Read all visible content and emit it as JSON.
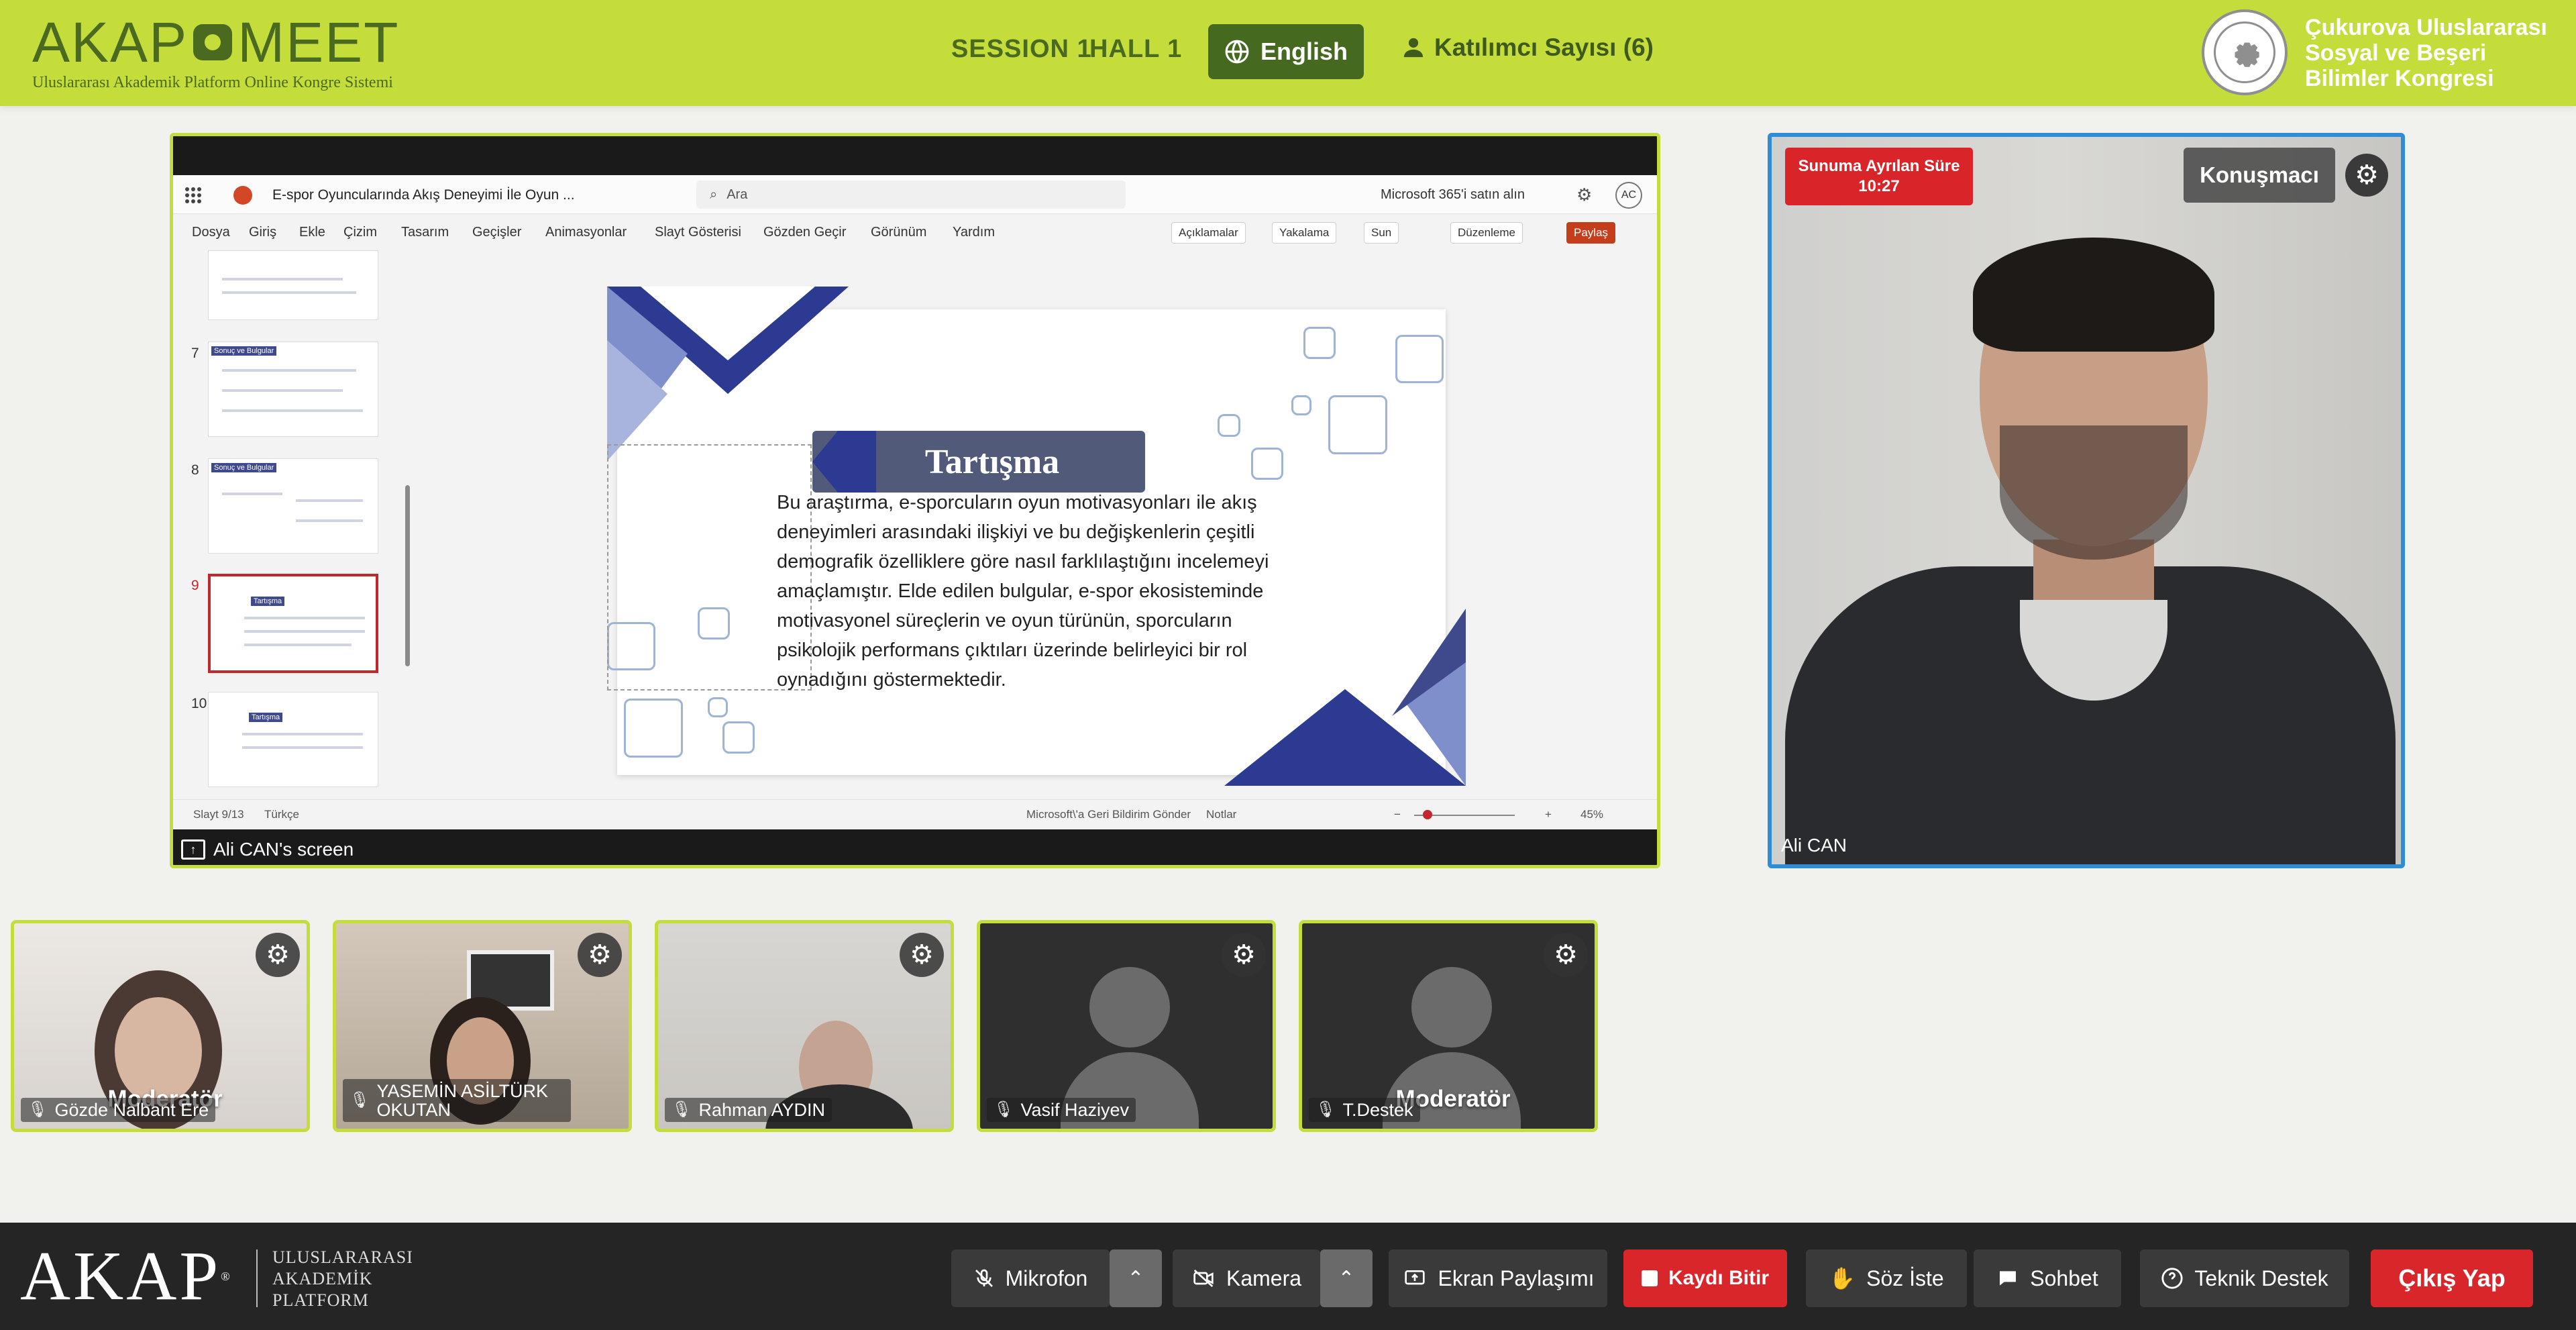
{
  "header": {
    "logo_text_left": "AKAP",
    "logo_text_right": "MEET",
    "logo_subtitle": "Uluslararası Akademik Platform Online Kongre Sistemi",
    "session": "SESSION 1",
    "hall": "HALL 1",
    "language_button": "English",
    "participants_label": "Katılımcı Sayısı (6)",
    "congress_name_line1": "Çukurova Uluslararası",
    "congress_name_line2": "Sosyal ve Beşeri",
    "congress_name_line3": "Bilimler Kongresi"
  },
  "presentation": {
    "share_label": "Ali CAN's screen",
    "ppt": {
      "doc_title": "E-spor Oyuncularında Akış Deneyimi İle Oyun ...",
      "search_placeholder": "Ara",
      "ms365": "Microsoft 365'i satın alın",
      "account_initials": "AC",
      "menu": [
        "Dosya",
        "Giriş",
        "Ekle",
        "Çizim",
        "Tasarım",
        "Geçişler",
        "Animasyonlar",
        "Slayt Gösterisi",
        "Gözden Geçir",
        "Görünüm",
        "Yardım"
      ],
      "ribbon": {
        "comments": "Açıklamalar",
        "catch": "Yakalama",
        "present": "Sun",
        "edit": "Düzenleme",
        "share": "Paylaş"
      },
      "thumbnails": [
        {
          "num": "7",
          "label": "Sonuç ve Bulgular"
        },
        {
          "num": "8",
          "label": "Sonuç ve Bulgular"
        },
        {
          "num": "9",
          "label": "Tartışma"
        },
        {
          "num": "10",
          "label": "Tartışma"
        }
      ],
      "slide": {
        "title": "Tartışma",
        "body": "Bu araştırma, e-sporcuların oyun motivasyonları ile akış deneyimleri arasındaki ilişkiyi ve bu değişkenlerin çeşitli demografik özelliklere göre nasıl farklılaştığını incelemeyi amaçlamıştır. Elde edilen bulgular, e-spor ekosisteminde motivasyonel süreçlerin ve oyun türünün, sporcuların psikolojik performans çıktıları üzerinde belirleyici bir rol oynadığını göstermektedir."
      },
      "status": {
        "slide_count": "Slayt 9/13",
        "language": "Türkçe",
        "feedback": "Microsoft\\'a Geri Bildirim Gönder",
        "notes": "Notlar",
        "zoom": "45%"
      }
    }
  },
  "speaker": {
    "timer_label": "Sunuma Ayrılan Süre",
    "timer_value": "10:27",
    "role": "Konuşmacı",
    "name": "Ali CAN"
  },
  "participants": [
    {
      "name": "Gözde Nalbant Ere",
      "role": "Moderatör"
    },
    {
      "name": "YASEMİN ASİLTÜRK OKUTAN",
      "role": ""
    },
    {
      "name": "Rahman AYDIN",
      "role": ""
    },
    {
      "name": "Vasif Haziyev",
      "role": ""
    },
    {
      "name": "T.Destek",
      "role": "Moderatör"
    }
  ],
  "footer": {
    "brand": "AKAP",
    "brand_line1": "ULUSLARARASI",
    "brand_line2": "AKADEMİK",
    "brand_line3": "PLATFORM",
    "buttons": {
      "mic": "Mikrofon",
      "camera": "Kamera",
      "screen_share": "Ekran Paylaşımı",
      "record": "Kaydı Bitir",
      "raise_hand": "Söz İste",
      "chat": "Sohbet",
      "support": "Teknik Destek",
      "exit": "Çıkış Yap"
    }
  },
  "colors": {
    "brand_green": "#c5dd3b",
    "dark_green": "#44691f",
    "danger_red": "#d8262b",
    "speaker_border": "#2f8cd6"
  }
}
